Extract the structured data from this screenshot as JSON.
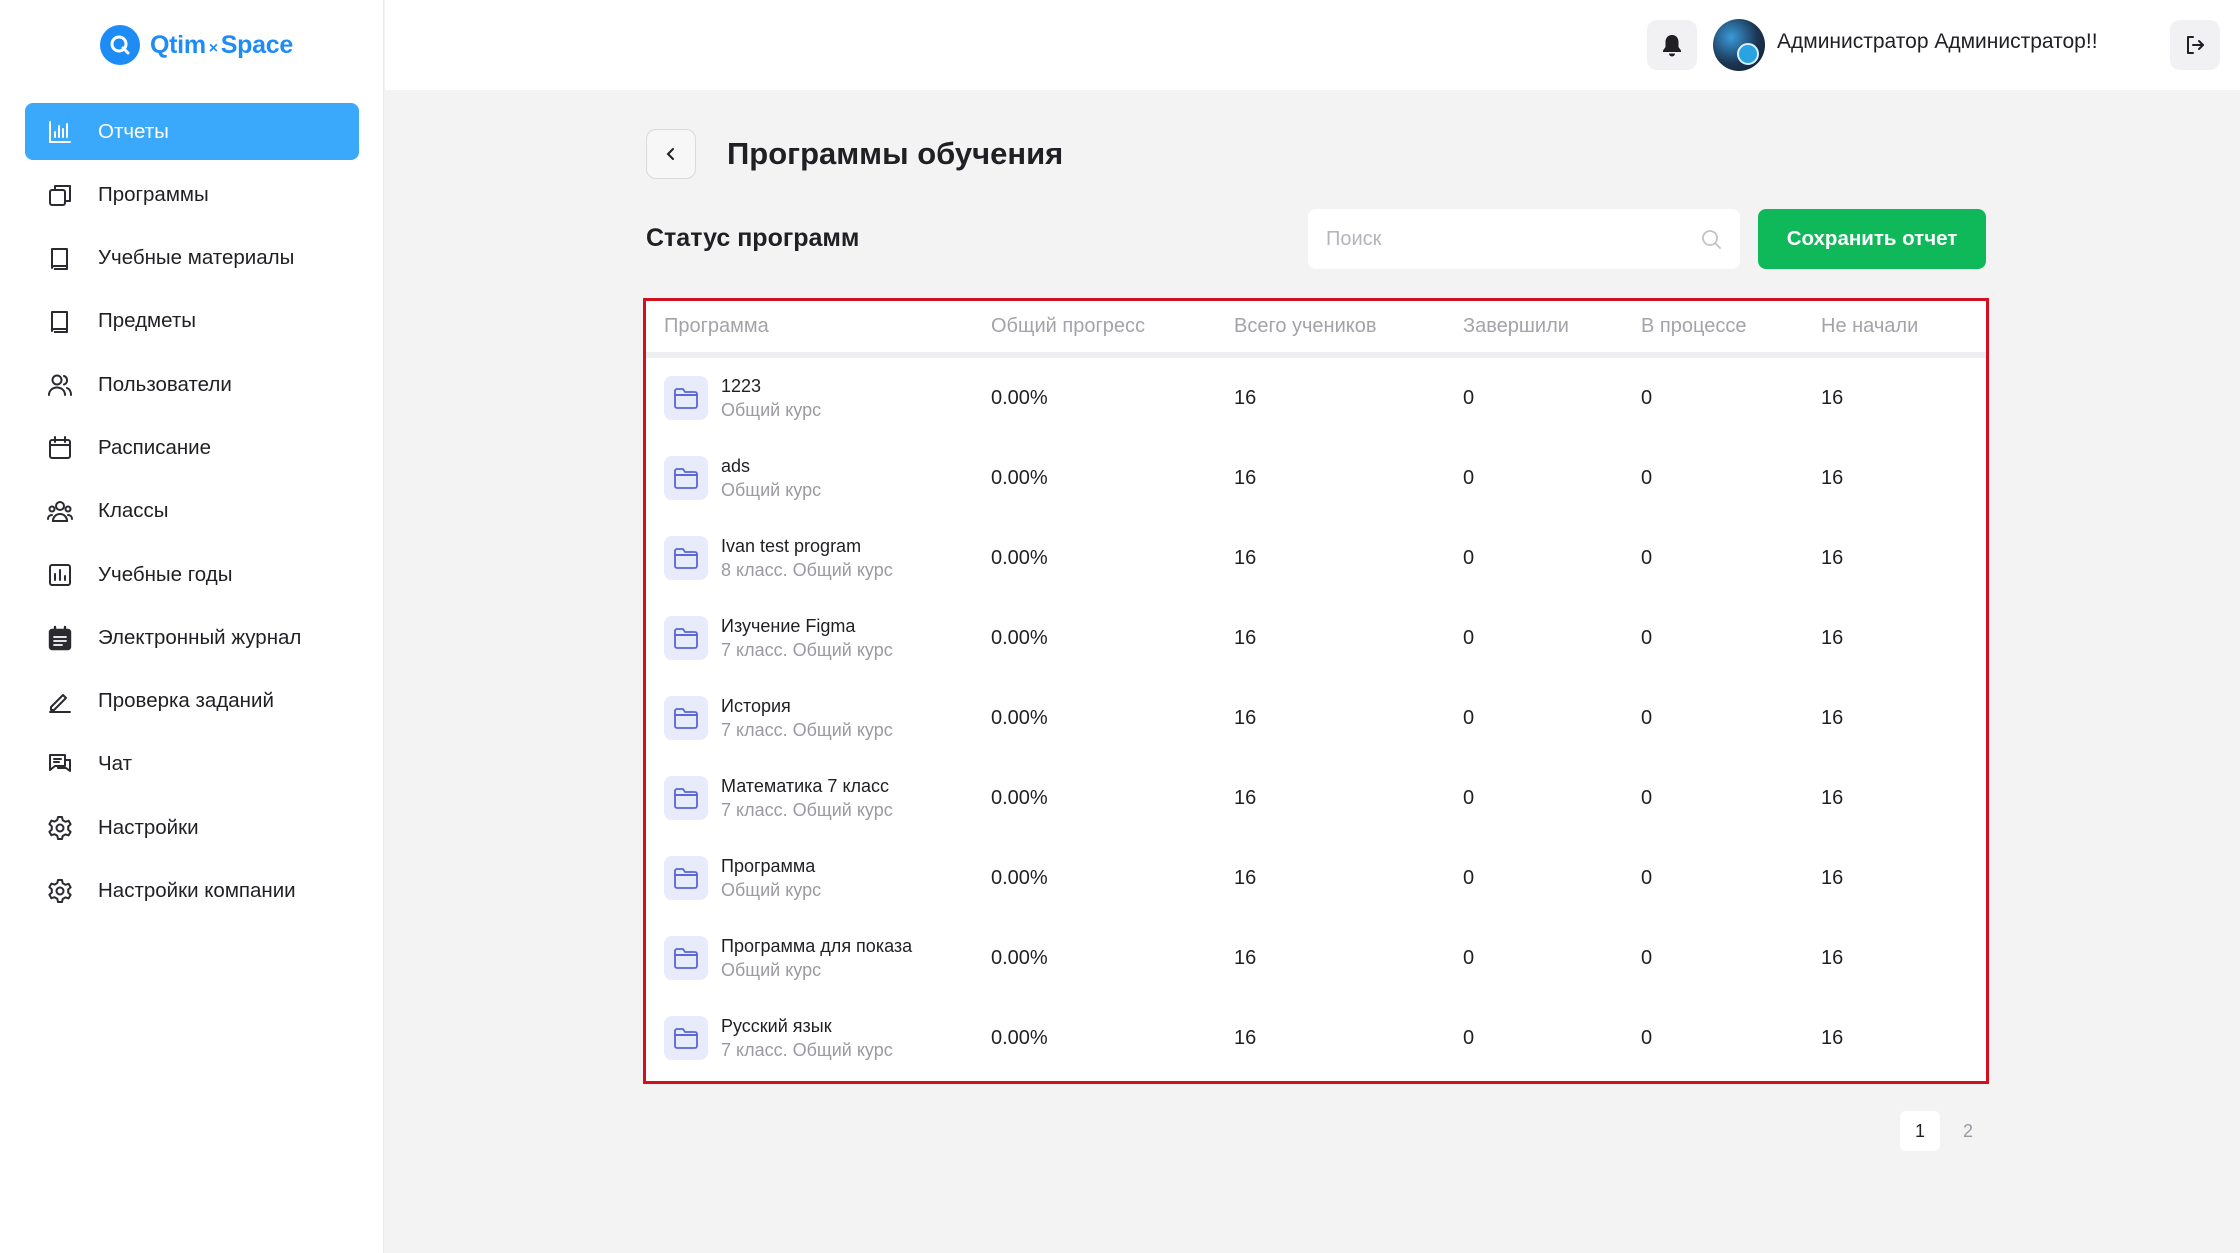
{
  "brand": {
    "name_left": "Qtim",
    "separator": "×",
    "name_right": "Space"
  },
  "sidebar": {
    "items": [
      {
        "label": "Отчеты",
        "icon": "bar-chart-icon",
        "active": true
      },
      {
        "label": "Программы",
        "icon": "copy-icon"
      },
      {
        "label": "Учебные материалы",
        "icon": "book-icon"
      },
      {
        "label": "Предметы",
        "icon": "book-icon"
      },
      {
        "label": "Пользователи",
        "icon": "users-icon"
      },
      {
        "label": "Расписание",
        "icon": "calendar-icon"
      },
      {
        "label": "Классы",
        "icon": "group-icon"
      },
      {
        "label": "Учебные годы",
        "icon": "chart-box-icon"
      },
      {
        "label": "Электронный журнал",
        "icon": "journal-icon"
      },
      {
        "label": "Проверка заданий",
        "icon": "pencil-icon"
      },
      {
        "label": "Чат",
        "icon": "chat-icon"
      },
      {
        "label": "Настройки",
        "icon": "gear-icon"
      },
      {
        "label": "Настройки компании",
        "icon": "gear-icon"
      }
    ]
  },
  "header": {
    "user_name": "Администратор Администратор!!"
  },
  "page": {
    "title": "Программы обучения",
    "section_title": "Статус программ",
    "search_placeholder": "Поиск",
    "save_label": "Сохранить отчет"
  },
  "table": {
    "columns": [
      "Программа",
      "Общий прогресс",
      "Всего учеников",
      "Завершили",
      "В процессе",
      "Не начали"
    ],
    "rows": [
      {
        "name": "1223",
        "sub": "Общий курс",
        "progress": "0.00%",
        "total": "16",
        "done": "0",
        "in_progress": "0",
        "not_started": "16"
      },
      {
        "name": "ads",
        "sub": "Общий курс",
        "progress": "0.00%",
        "total": "16",
        "done": "0",
        "in_progress": "0",
        "not_started": "16"
      },
      {
        "name": "Ivan test program",
        "sub": "8 класс. Общий курс",
        "progress": "0.00%",
        "total": "16",
        "done": "0",
        "in_progress": "0",
        "not_started": "16"
      },
      {
        "name": "Изучение Figma",
        "sub": "7 класс. Общий курс",
        "progress": "0.00%",
        "total": "16",
        "done": "0",
        "in_progress": "0",
        "not_started": "16"
      },
      {
        "name": "История",
        "sub": "7 класс. Общий курс",
        "progress": "0.00%",
        "total": "16",
        "done": "0",
        "in_progress": "0",
        "not_started": "16"
      },
      {
        "name": "Математика 7 класс",
        "sub": "7 класс. Общий курс",
        "progress": "0.00%",
        "total": "16",
        "done": "0",
        "in_progress": "0",
        "not_started": "16"
      },
      {
        "name": "Программа",
        "sub": "Общий курс",
        "progress": "0.00%",
        "total": "16",
        "done": "0",
        "in_progress": "0",
        "not_started": "16"
      },
      {
        "name": "Программа для показа",
        "sub": "Общий курс",
        "progress": "0.00%",
        "total": "16",
        "done": "0",
        "in_progress": "0",
        "not_started": "16"
      },
      {
        "name": "Русский язык",
        "sub": "7 класс. Общий курс",
        "progress": "0.00%",
        "total": "16",
        "done": "0",
        "in_progress": "0",
        "not_started": "16"
      }
    ]
  },
  "pagination": {
    "pages": [
      "1",
      "2"
    ],
    "current": "1"
  },
  "colors": {
    "accent": "#3aa9fb",
    "brand": "#1e8cf5",
    "save": "#0fb95a",
    "highlight_border": "#d21020"
  }
}
